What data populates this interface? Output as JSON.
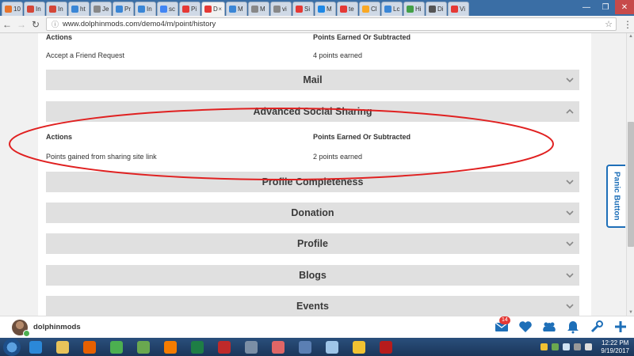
{
  "browser": {
    "tabs": [
      {
        "label": "10",
        "color": "#e8742b"
      },
      {
        "label": "In",
        "color": "#d44638"
      },
      {
        "label": "In",
        "color": "#d44638"
      },
      {
        "label": "ht",
        "color": "#3a86d6"
      },
      {
        "label": "Je",
        "color": "#888888"
      },
      {
        "label": "Pr",
        "color": "#3a86d6"
      },
      {
        "label": "In",
        "color": "#3a86d6"
      },
      {
        "label": "sc",
        "color": "#4285f4"
      },
      {
        "label": "Pi",
        "color": "#e53935"
      },
      {
        "label": "D",
        "color": "#e53935"
      },
      {
        "label": "M",
        "color": "#3a86d6"
      },
      {
        "label": "M",
        "color": "#888888"
      },
      {
        "label": "vi",
        "color": "#888888"
      },
      {
        "label": "Si",
        "color": "#e53935"
      },
      {
        "label": "M",
        "color": "#1e88e5"
      },
      {
        "label": "te",
        "color": "#e53935"
      },
      {
        "label": "Cl",
        "color": "#f9a825"
      },
      {
        "label": "Lc",
        "color": "#3a86d6"
      },
      {
        "label": "Hi",
        "color": "#43a047"
      },
      {
        "label": "Di",
        "color": "#555555"
      },
      {
        "label": "Vi",
        "color": "#e53935"
      }
    ],
    "active_tab_index": 9,
    "active_tab_close": "×",
    "window_controls": {
      "minimize": "—",
      "maximize": "❐",
      "close": "✕"
    },
    "url": "www.dolphinmods.com/demo4/m/point/history"
  },
  "page": {
    "top_section": {
      "col_actions": "Actions",
      "col_points": "Points Earned Or Subtracted",
      "row_action": "Accept a Friend Request",
      "row_points": "4 points earned"
    },
    "sections": [
      {
        "title": "Mail",
        "expanded": false
      },
      {
        "title": "Advanced Social Sharing",
        "expanded": true
      },
      {
        "title": "Profile Completeness",
        "expanded": false
      },
      {
        "title": "Donation",
        "expanded": false
      },
      {
        "title": "Profile",
        "expanded": false
      },
      {
        "title": "Blogs",
        "expanded": false
      },
      {
        "title": "Events",
        "expanded": false
      }
    ],
    "sharing_section": {
      "col_actions": "Actions",
      "col_points": "Points Earned Or Subtracted",
      "row_action": "Points gained from sharing site link",
      "row_points": "2 points earned"
    },
    "annotation_color": "#e02020",
    "panic_button": "Panic Button"
  },
  "userbar": {
    "username": "dolphinmods",
    "mail_badge": "14",
    "accent": "#1e6fb8"
  },
  "taskbar": {
    "time": "12:22 PM",
    "date": "9/19/2017",
    "apps": [
      {
        "name": "ie",
        "color": "#2b88d8"
      },
      {
        "name": "explorer",
        "color": "#e8c35a"
      },
      {
        "name": "firefox",
        "color": "#e66000"
      },
      {
        "name": "chrome",
        "color": "#4caf50"
      },
      {
        "name": "frog",
        "color": "#6aa84f"
      },
      {
        "name": "media",
        "color": "#f57c00"
      },
      {
        "name": "excel",
        "color": "#1e7e45"
      },
      {
        "name": "filezilla",
        "color": "#bf2a2a"
      },
      {
        "name": "tool",
        "color": "#7b8fa6"
      },
      {
        "name": "eraser",
        "color": "#e06666"
      },
      {
        "name": "app",
        "color": "#5b7fb3"
      },
      {
        "name": "paint",
        "color": "#9fc5e8"
      },
      {
        "name": "outlook",
        "color": "#f1c232"
      },
      {
        "name": "acrobat",
        "color": "#b71c1c"
      }
    ]
  }
}
